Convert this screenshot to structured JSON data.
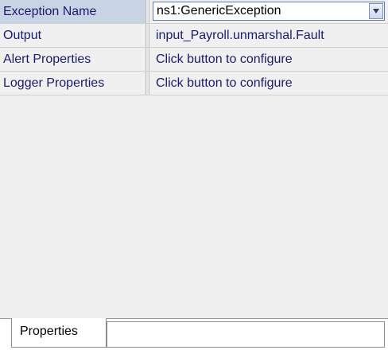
{
  "properties": {
    "rows": [
      {
        "name": "Exception Name",
        "value": "ns1:GenericException",
        "control": "dropdown"
      },
      {
        "name": "Output",
        "value": "input_Payroll.unmarshal.Fault",
        "control": "text"
      },
      {
        "name": "Alert Properties",
        "value": "Click button to configure",
        "control": "button"
      },
      {
        "name": "Logger Properties",
        "value": "Click button to configure",
        "control": "button"
      }
    ]
  },
  "tabs": {
    "active_label": "Properties"
  },
  "icons": {
    "dropdown": "chevron-down-icon"
  }
}
